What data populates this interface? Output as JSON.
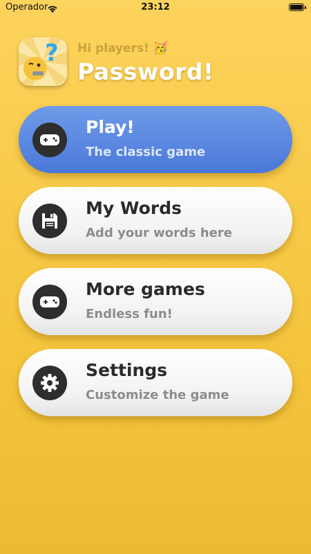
{
  "status_bar": {
    "carrier": "Operador",
    "time": "23:12"
  },
  "header": {
    "greeting": "Hi players! 🥳",
    "title": "Password!"
  },
  "menu": [
    {
      "title": "Play!",
      "subtitle": "The classic game",
      "icon": "gamepad-icon"
    },
    {
      "title": "My Words",
      "subtitle": "Add your words here",
      "icon": "floppy-disk-icon"
    },
    {
      "title": "More games",
      "subtitle": "Endless fun!",
      "icon": "gamepad-icon"
    },
    {
      "title": "Settings",
      "subtitle": "Customize the game",
      "icon": "gear-icon"
    }
  ],
  "colors": {
    "background": "#F8CB47",
    "play_card": "#4A78D8",
    "card": "#FFFFFF",
    "icon_circle": "#2E2E2E"
  }
}
